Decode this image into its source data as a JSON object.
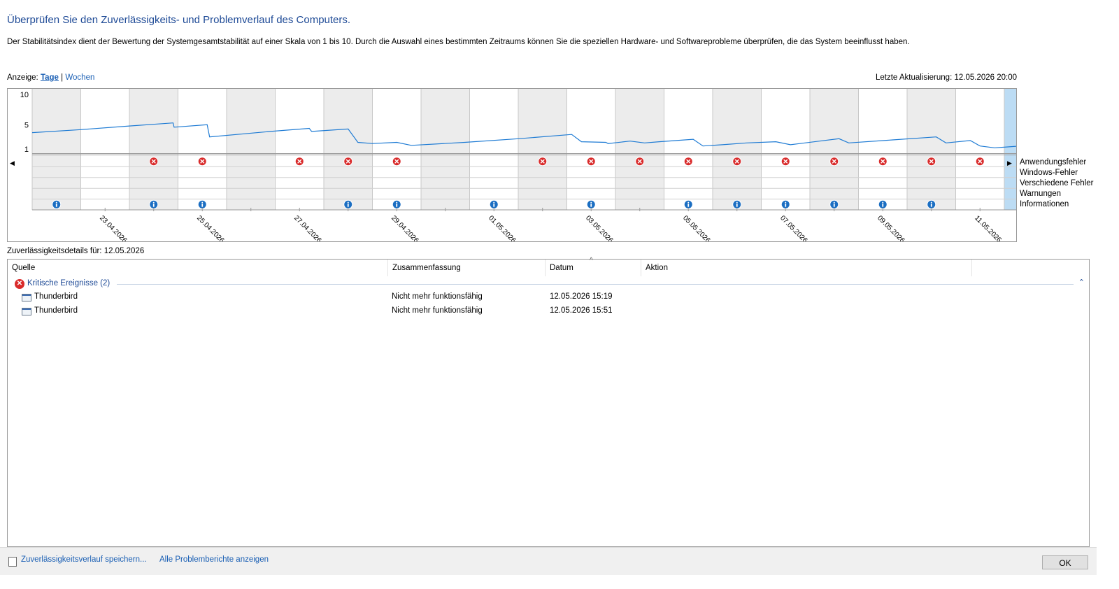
{
  "header": {
    "title": "Überprüfen Sie den Zuverlässigkeits- und Problemverlauf des Computers.",
    "description": "Der Stabilitätsindex dient der Bewertung der Systemgesamtstabilität auf einer Skala von 1 bis 10. Durch die Auswahl eines bestimmten Zeitraums können Sie die speziellen Hardware- und Softwareprobleme überprüfen, die das System beeinflusst haben."
  },
  "view": {
    "label": "Anzeige:",
    "days": "Tage",
    "separator": "|",
    "weeks": "Wochen",
    "last_update": "Letzte Aktualisierung: 12.05.2026 20:00"
  },
  "chart_data": {
    "type": "line",
    "y_ticks": [
      "10",
      "5",
      "1"
    ],
    "ylim": [
      1,
      10
    ],
    "columns": [
      "22.04.2026",
      "23.04.2026",
      "24.04.2026",
      "25.04.2026",
      "26.04.2026",
      "27.04.2026",
      "28.04.2026",
      "29.04.2026",
      "30.04.2026",
      "01.05.2026",
      "02.05.2026",
      "03.05.2026",
      "04.05.2026",
      "05.05.2026",
      "06.05.2026",
      "07.05.2026",
      "08.05.2026",
      "09.05.2026",
      "10.05.2026",
      "11.05.2026",
      "12.05.2026"
    ],
    "date_labels": [
      "23.04.2026",
      "25.04.2026",
      "27.04.2026",
      "29.04.2026",
      "01.05.2026",
      "03.05.2026",
      "05.05.2026",
      "07.05.2026",
      "09.05.2026",
      "11.05.2026"
    ],
    "stability": [
      [
        0.0,
        3.7
      ],
      [
        1.0,
        4.2
      ],
      [
        2.0,
        4.8
      ],
      [
        2.9,
        5.3
      ],
      [
        2.92,
        4.6
      ],
      [
        3.6,
        5.0
      ],
      [
        3.65,
        3.0
      ],
      [
        4.9,
        3.9
      ],
      [
        5.7,
        4.4
      ],
      [
        5.75,
        3.9
      ],
      [
        6.5,
        4.3
      ],
      [
        6.7,
        2.1
      ],
      [
        7.0,
        1.9
      ],
      [
        7.5,
        2.1
      ],
      [
        7.8,
        1.6
      ],
      [
        8.9,
        2.1
      ],
      [
        10.0,
        2.7
      ],
      [
        11.1,
        3.4
      ],
      [
        11.3,
        2.2
      ],
      [
        11.8,
        2.1
      ],
      [
        11.85,
        1.9
      ],
      [
        12.3,
        2.3
      ],
      [
        12.6,
        2.0
      ],
      [
        12.9,
        2.2
      ],
      [
        13.6,
        2.6
      ],
      [
        13.8,
        1.5
      ],
      [
        14.2,
        1.7
      ],
      [
        14.7,
        2.0
      ],
      [
        15.3,
        2.2
      ],
      [
        15.6,
        1.7
      ],
      [
        16.2,
        2.3
      ],
      [
        16.6,
        2.7
      ],
      [
        16.8,
        2.0
      ],
      [
        17.7,
        2.5
      ],
      [
        18.6,
        3.0
      ],
      [
        18.8,
        2.0
      ],
      [
        19.3,
        2.4
      ],
      [
        19.5,
        1.5
      ],
      [
        19.8,
        1.2
      ],
      [
        20.0,
        1.3
      ],
      [
        21.0,
        1.9
      ]
    ],
    "rows": [
      "Anwendungsfehler",
      "Windows-Fehler",
      "Verschiedene Fehler",
      "Warnungen",
      "Informationen"
    ],
    "application_errors": [
      "24.04.2026",
      "25.04.2026",
      "27.04.2026",
      "28.04.2026",
      "29.04.2026",
      "02.05.2026",
      "03.05.2026",
      "04.05.2026",
      "05.05.2026",
      "06.05.2026",
      "07.05.2026",
      "08.05.2026",
      "09.05.2026",
      "10.05.2026",
      "11.05.2026"
    ],
    "information": [
      "22.04.2026",
      "24.04.2026",
      "25.04.2026",
      "28.04.2026",
      "29.04.2026",
      "01.05.2026",
      "03.05.2026",
      "05.05.2026",
      "06.05.2026",
      "07.05.2026",
      "08.05.2026",
      "09.05.2026",
      "10.05.2026"
    ],
    "selected": "12.05.2026"
  },
  "details": {
    "label": "Zuverlässigkeitsdetails für: 12.05.2026",
    "columns": [
      "Quelle",
      "Zusammenfassung",
      "Datum",
      "Aktion"
    ],
    "group": "Kritische Ereignisse (2)",
    "rows": [
      {
        "source": "Thunderbird",
        "summary": "Nicht mehr funktionsfähig",
        "date": "12.05.2026 15:19",
        "action": ""
      },
      {
        "source": "Thunderbird",
        "summary": "Nicht mehr funktionsfähig",
        "date": "12.05.2026 15:51",
        "action": ""
      }
    ]
  },
  "footer": {
    "save_link": "Zuverlässigkeitsverlauf speichern...",
    "all_reports_link": "Alle Problemberichte anzeigen",
    "ok_label": "OK"
  },
  "colors": {
    "title": "#1e4a96",
    "link": "#1a5fb4",
    "line": "#1e7bd4",
    "selected": "#bcdcf4",
    "error": "#d92b2b",
    "info": "#1b6ec2"
  }
}
